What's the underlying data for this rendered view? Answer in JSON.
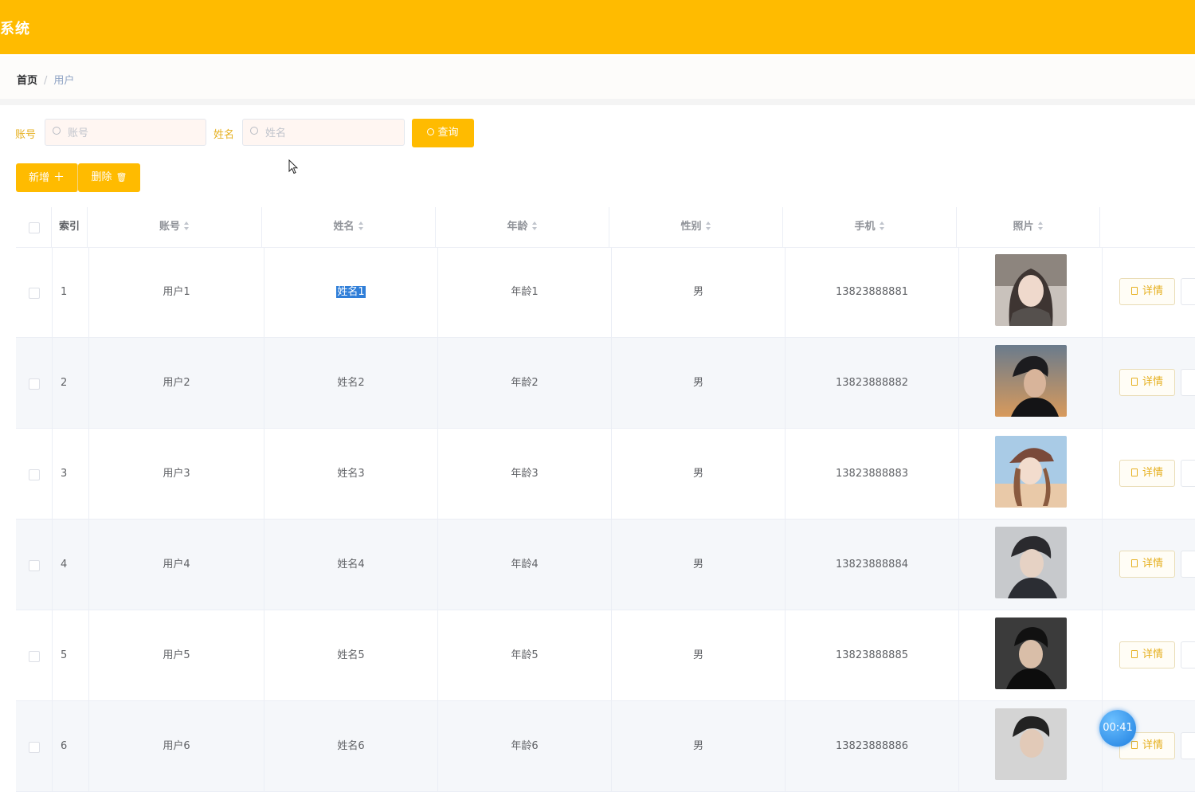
{
  "header": {
    "title": "系统"
  },
  "breadcrumb": {
    "home": "首页",
    "separator": "/",
    "current": "用户"
  },
  "filters": {
    "account_label": "账号",
    "account_placeholder": "账号",
    "name_label": "姓名",
    "name_placeholder": "姓名",
    "query_label": "查询"
  },
  "toolbar": {
    "add_label": "新增",
    "add_icon": "＋",
    "delete_label": "删除",
    "delete_icon": "🗑"
  },
  "table": {
    "columns": [
      "索引",
      "账号",
      "姓名",
      "年龄",
      "性别",
      "手机",
      "照片"
    ],
    "detail_label": "详情",
    "rows": [
      {
        "index": "1",
        "account": "用户1",
        "name": "姓名1",
        "age": "年龄1",
        "gender": "男",
        "phone": "13823888881"
      },
      {
        "index": "2",
        "account": "用户2",
        "name": "姓名2",
        "age": "年龄2",
        "gender": "男",
        "phone": "13823888882"
      },
      {
        "index": "3",
        "account": "用户3",
        "name": "姓名3",
        "age": "年龄3",
        "gender": "男",
        "phone": "13823888883"
      },
      {
        "index": "4",
        "account": "用户4",
        "name": "姓名4",
        "age": "年龄4",
        "gender": "男",
        "phone": "13823888884"
      },
      {
        "index": "5",
        "account": "用户5",
        "name": "姓名5",
        "age": "年龄5",
        "gender": "男",
        "phone": "13823888885"
      },
      {
        "index": "6",
        "account": "用户6",
        "name": "姓名6",
        "age": "年龄6",
        "gender": "男",
        "phone": "13823888886"
      }
    ]
  },
  "recorder": {
    "time": "00:41"
  },
  "colors": {
    "accent": "#ffbb00",
    "selection": "#2f7ed8"
  }
}
